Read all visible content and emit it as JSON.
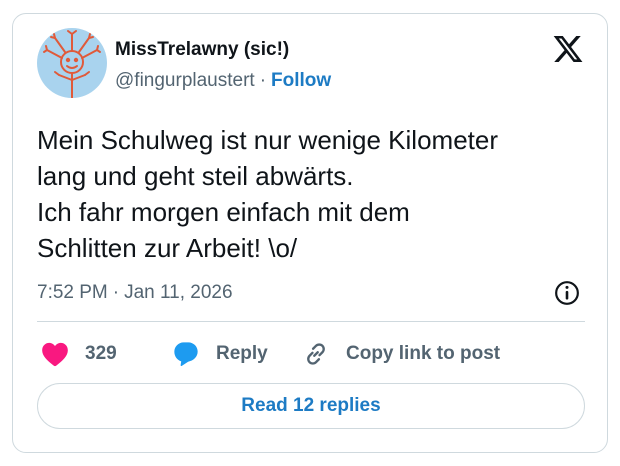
{
  "author": {
    "display_name": "MissTrelawny (sic!)",
    "handle": "@fingurplaustert",
    "separator": "·",
    "follow_label": "Follow"
  },
  "tweet": {
    "lines": [
      "Mein Schulweg ist nur wenige Kilometer",
      "lang und geht steil abwärts.",
      "Ich fahr morgen einfach mit dem",
      "Schlitten zur Arbeit! \\o/"
    ],
    "time": "7:52 PM",
    "separator": "·",
    "date": "Jan 11, 2026"
  },
  "actions": {
    "like_count": "329",
    "reply_label": "Reply",
    "copy_label": "Copy link to post"
  },
  "read_replies_label": "Read 12 replies",
  "colors": {
    "like": "#f91880",
    "reply": "#1d9bf0",
    "link": "#1d7bc4",
    "muted": "#536471",
    "text": "#0f1419",
    "border": "#cfd9de",
    "avatar_bg": "#a9d3ee"
  },
  "icons": {
    "logo": "x-logo-icon",
    "like": "heart-icon",
    "reply": "speech-bubble-icon",
    "copy": "link-icon",
    "info": "info-icon"
  }
}
